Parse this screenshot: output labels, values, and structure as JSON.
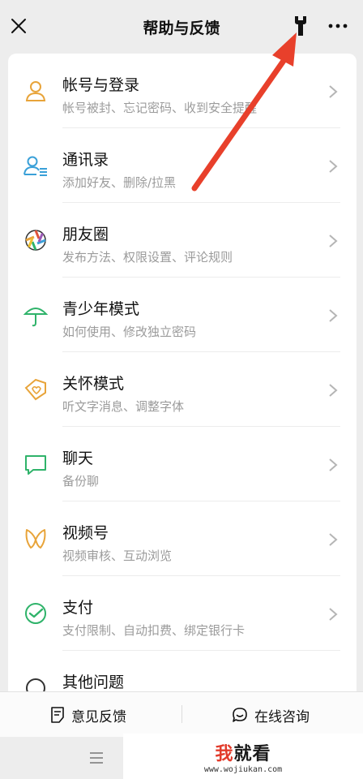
{
  "nav": {
    "title": "帮助与反馈",
    "close_icon": "close-icon",
    "wrench_icon": "wrench-icon",
    "more_icon": "more-icon"
  },
  "items": [
    {
      "title": "帐号与登录",
      "subtitle": "帐号被封、忘记密码、收到安全提醒",
      "icon": "user-icon",
      "color": "#e8a43a"
    },
    {
      "title": "通讯录",
      "subtitle": "添加好友、删除/拉黑",
      "icon": "contacts-icon",
      "color": "#3aa0d8"
    },
    {
      "title": "朋友圈",
      "subtitle": "发布方法、权限设置、评论规则",
      "icon": "moments-icon",
      "color": "#e0533b"
    },
    {
      "title": "青少年模式",
      "subtitle": "如何使用、修改独立密码",
      "icon": "umbrella-icon",
      "color": "#2fb36a"
    },
    {
      "title": "关怀模式",
      "subtitle": "听文字消息、调整字体",
      "icon": "tag-heart-icon",
      "color": "#e8a43a"
    },
    {
      "title": "聊天",
      "subtitle": "备份聊",
      "icon": "chat-icon",
      "color": "#2fb36a"
    },
    {
      "title": "视频号",
      "subtitle": "视频审核、互动浏览",
      "icon": "channels-icon",
      "color": "#e8a43a"
    },
    {
      "title": "支付",
      "subtitle": "支付限制、自动扣费、绑定银行卡",
      "icon": "pay-icon",
      "color": "#2fb36a"
    },
    {
      "title": "其他问题",
      "subtitle": "",
      "icon": "other-icon",
      "color": "#333333"
    }
  ],
  "bottom": {
    "feedback_label": "意见反馈",
    "consult_label": "在线咨询"
  },
  "watermark": {
    "brand_prefix": "我",
    "brand_suffix": "就看",
    "url": "www.wojiukan.com"
  }
}
